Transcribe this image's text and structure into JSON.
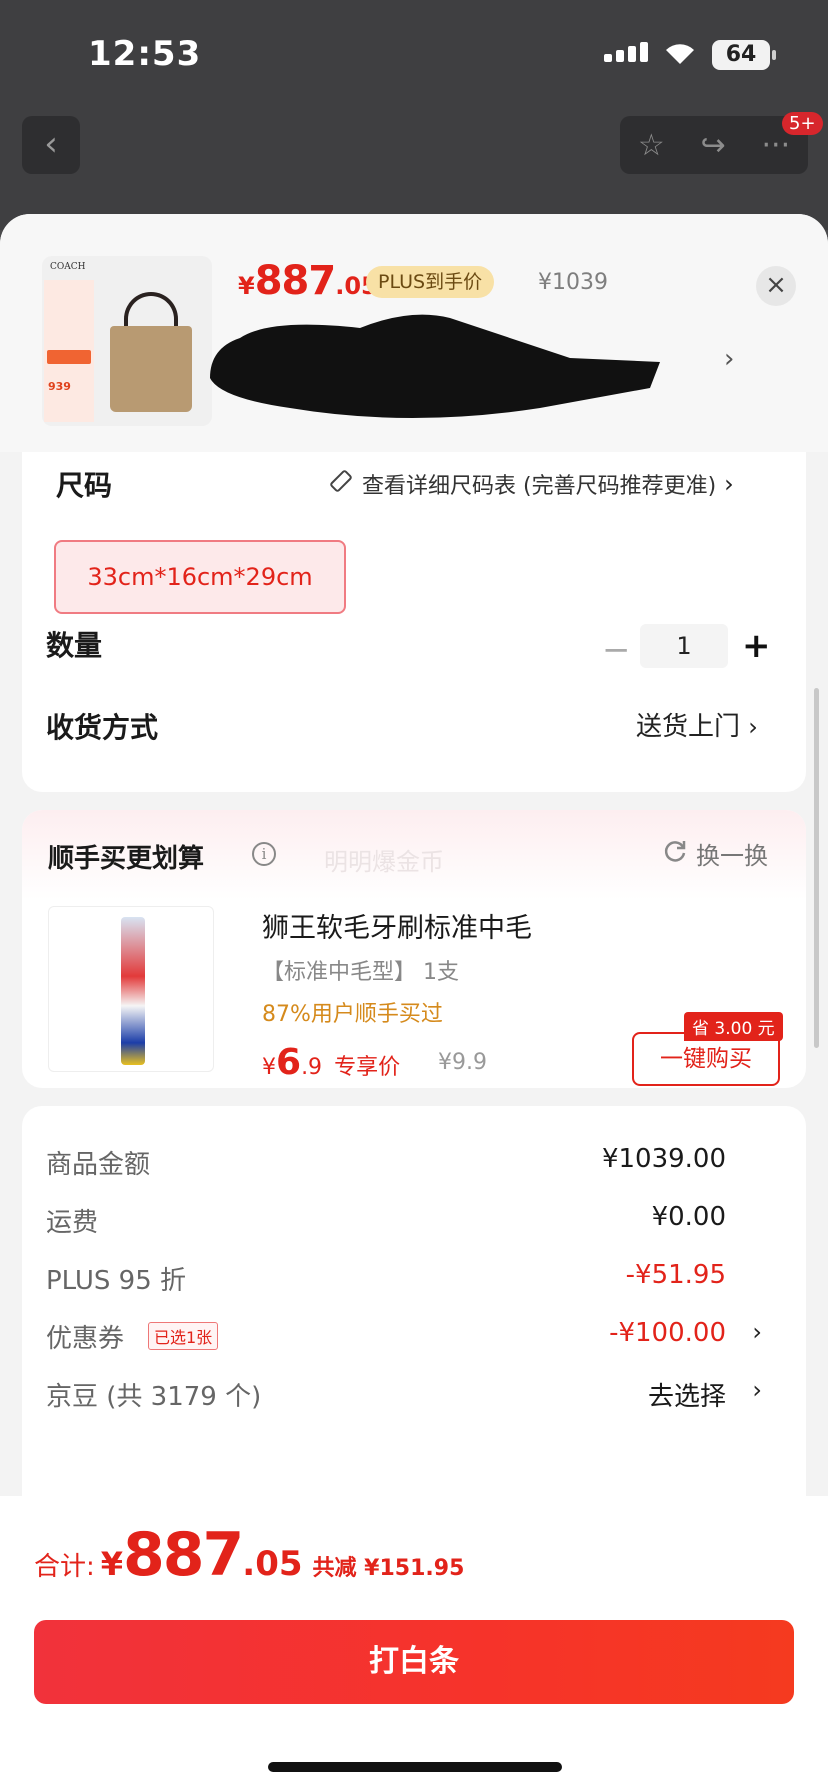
{
  "status_bar": {
    "time": "12:53",
    "battery": "64"
  },
  "nav": {
    "badge": "5+"
  },
  "product": {
    "brand": "COACH",
    "price_currency": "¥",
    "price_int": "887",
    "price_dec": ".05",
    "plus_label": "PLUS到手价",
    "original_price": "¥1039",
    "image_tag_price": "939"
  },
  "size_section": {
    "title": "尺码",
    "chart_link": "查看详细尺码表 (完善尺码推荐更准)",
    "selected_option": "33cm*16cm*29cm"
  },
  "quantity": {
    "label": "数量",
    "value": "1"
  },
  "delivery": {
    "label": "收货方式",
    "value": "送货上门"
  },
  "addon": {
    "title": "顺手买更划算",
    "ghost_text": "明明爆金币",
    "swap_label": "换一换",
    "product_name": "狮王软毛牙刷标准中毛",
    "spec": "【标准中毛型】 1支",
    "rate": "87%用户顺手买过",
    "price_currency": "¥",
    "price_int": "6",
    "price_dec": ".9",
    "price_label": "专享价",
    "original_price": "¥9.9",
    "save_tag": "省 3.00 元",
    "buy_label": "一键购买"
  },
  "summary": {
    "rows": [
      {
        "label": "商品金额",
        "value": "¥1039.00"
      },
      {
        "label": "运费",
        "value": "¥0.00"
      },
      {
        "label": "PLUS 95 折",
        "value": "-¥51.95"
      },
      {
        "label": "优惠券",
        "badge": "已选1张",
        "value": "-¥100.00"
      },
      {
        "label": "京豆 (共 3179 个)",
        "value": "去选择"
      }
    ]
  },
  "footer": {
    "total_label": "合计:",
    "currency": "¥",
    "total_int": "887",
    "total_dec": ".05",
    "savings": "共减 ¥151.95",
    "pay_button": "打白条"
  },
  "colors": {
    "accent": "#e2231a",
    "plus_badge_bg": "#f8e1a6",
    "button": "#f1323b"
  }
}
